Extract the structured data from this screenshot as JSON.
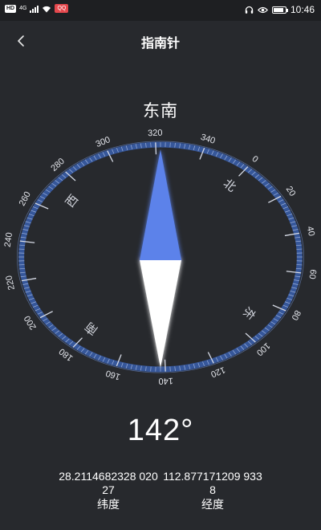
{
  "status_bar": {
    "hd": "HD",
    "network": "4G",
    "app_badge": "QQ",
    "time": "10:46",
    "battery_level": 0.85,
    "icons": [
      "hd-icon",
      "signal-icon",
      "wifi-icon",
      "headset-icon",
      "eye-icon",
      "battery-icon"
    ]
  },
  "header": {
    "title": "指南针",
    "back_icon": "chevron-left-icon"
  },
  "compass": {
    "direction": "东南",
    "heading_display": "142°",
    "heading_value": 142,
    "degree_labels": [
      "0",
      "20",
      "40",
      "60",
      "80",
      "100",
      "120",
      "140",
      "160",
      "180",
      "200",
      "220",
      "240",
      "260",
      "280",
      "300",
      "320",
      "340"
    ],
    "cardinal_labels": {
      "north": "北",
      "east": "东",
      "south": "南",
      "west": "西"
    },
    "needle_colors": {
      "north": "#5b82ea",
      "south": "#ffffff"
    },
    "ring_color": "#3a5fae"
  },
  "coordinates": {
    "latitude": {
      "value": "28.2114682328 02027",
      "label": "纬度"
    },
    "longitude": {
      "value": "112.877171209 9338",
      "label": "经度"
    }
  }
}
